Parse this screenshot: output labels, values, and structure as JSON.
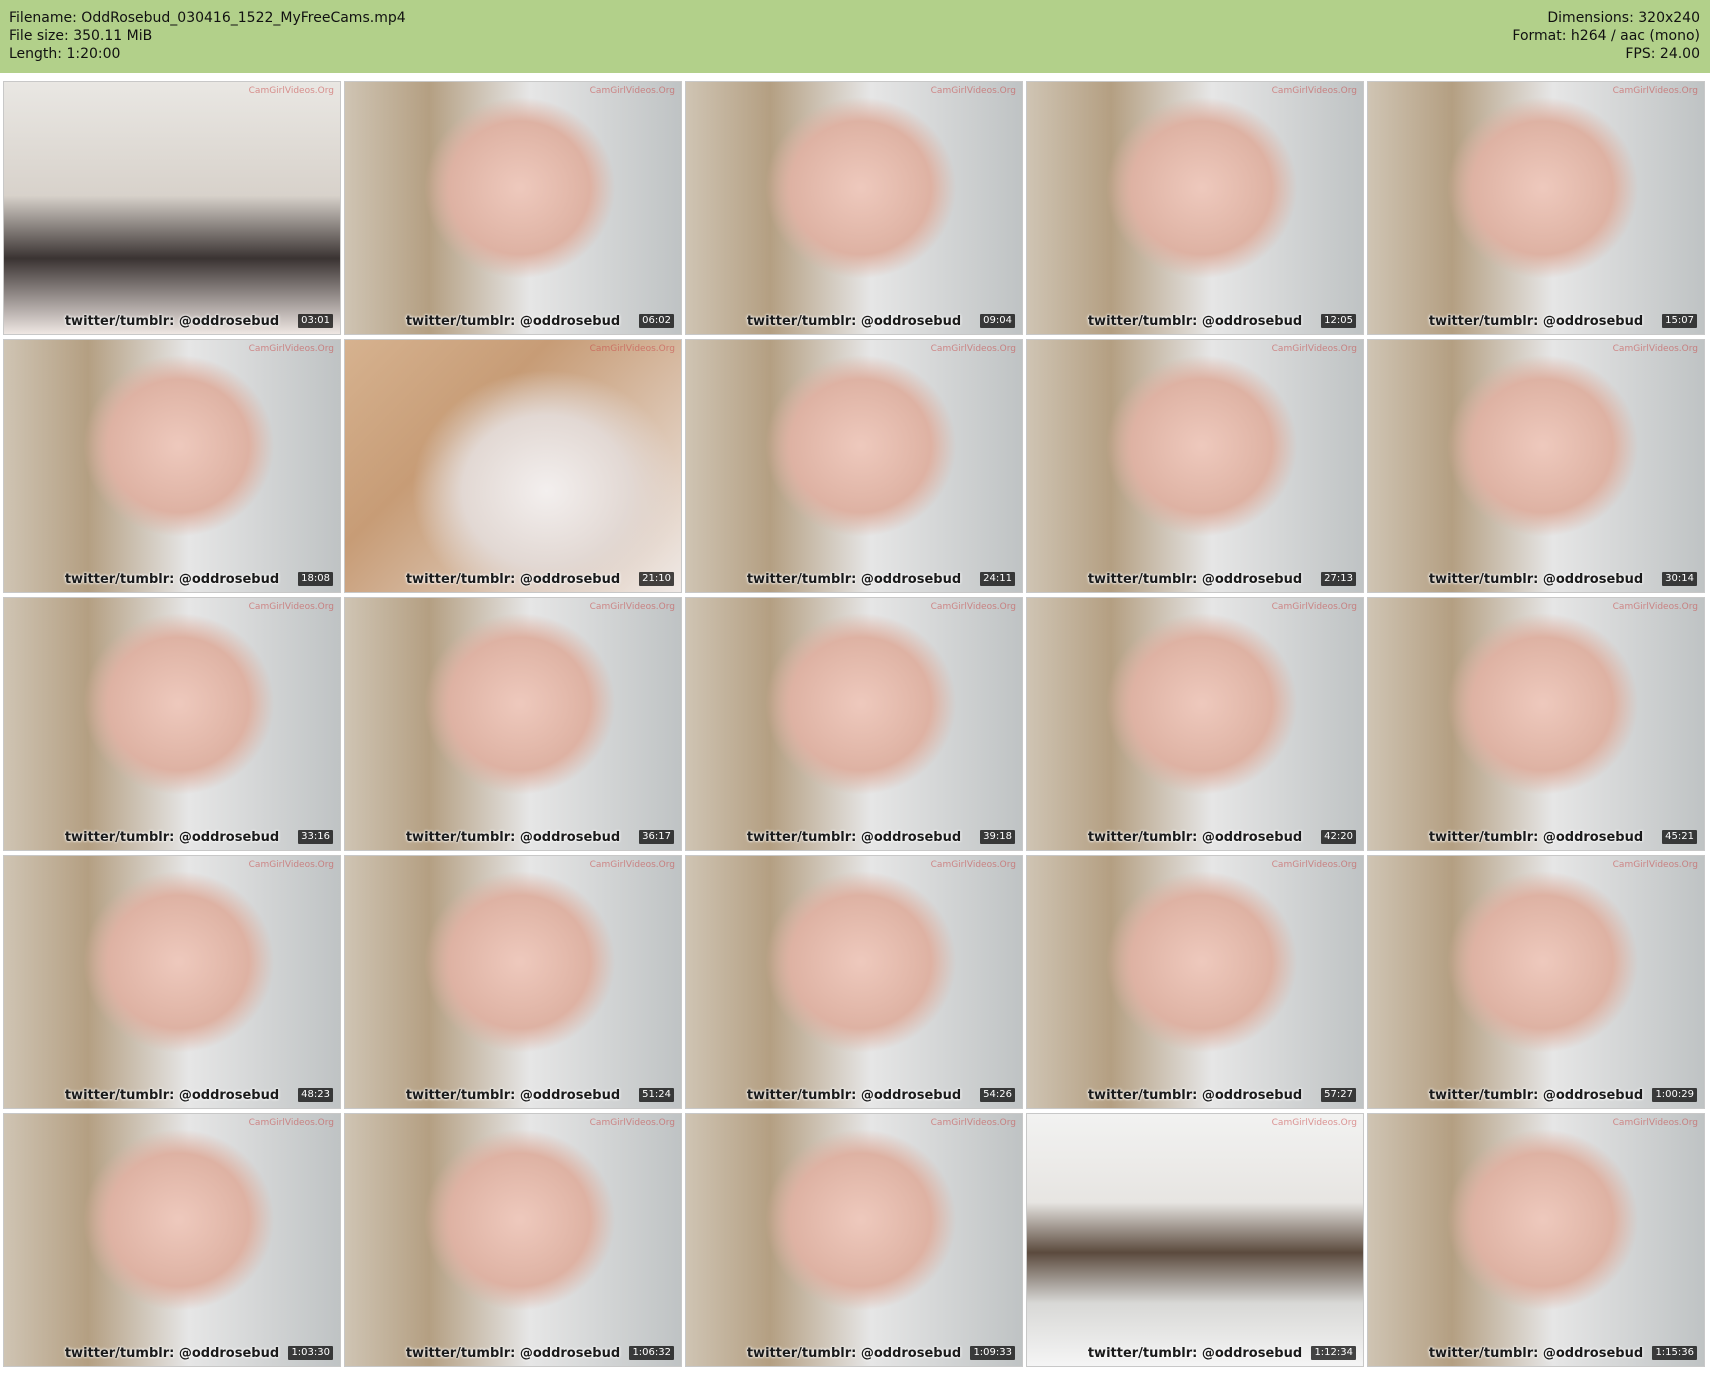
{
  "header": {
    "filename_line": "Filename: OddRosebud_030416_1522_MyFreeCams.mp4",
    "filesize_line": "File size: 350.11 MiB",
    "length_line": "Length: 1:20:00",
    "dimensions_line": "Dimensions: 320x240",
    "format_line": "Format: h264 / aac (mono)",
    "fps_line": "FPS: 24.00"
  },
  "watermark": "CamGirlVideos.Org",
  "thumbnails": [
    {
      "caption": "twitter/tumblr: @oddrosebud",
      "time": "03:01",
      "scene": "kitchen-wide"
    },
    {
      "caption": "twitter/tumblr: @oddrosebud",
      "time": "06:02",
      "scene": "face-closeup"
    },
    {
      "caption": "twitter/tumblr: @oddrosebud",
      "time": "09:04",
      "scene": "face-closeup"
    },
    {
      "caption": "twitter/tumblr: @oddrosebud",
      "time": "12:05",
      "scene": "face-closeup"
    },
    {
      "caption": "twitter/tumblr: @oddrosebud",
      "time": "15:07",
      "scene": "face-closeup"
    },
    {
      "caption": "twitter/tumblr: @oddrosebud",
      "time": "18:08",
      "scene": "face-closeup"
    },
    {
      "caption": "twitter/tumblr: @oddrosebud",
      "time": "21:10",
      "scene": "blurry"
    },
    {
      "caption": "twitter/tumblr: @oddrosebud",
      "time": "24:11",
      "scene": "face-closeup"
    },
    {
      "caption": "twitter/tumblr: @oddrosebud",
      "time": "27:13",
      "scene": "face-closeup"
    },
    {
      "caption": "twitter/tumblr: @oddrosebud",
      "time": "30:14",
      "scene": "face-closeup"
    },
    {
      "caption": "twitter/tumblr: @oddrosebud",
      "time": "33:16",
      "scene": "face-closeup"
    },
    {
      "caption": "twitter/tumblr: @oddrosebud",
      "time": "36:17",
      "scene": "face-closeup"
    },
    {
      "caption": "twitter/tumblr: @oddrosebud",
      "time": "39:18",
      "scene": "face-closeup"
    },
    {
      "caption": "twitter/tumblr: @oddrosebud",
      "time": "42:20",
      "scene": "face-closeup"
    },
    {
      "caption": "twitter/tumblr: @oddrosebud",
      "time": "45:21",
      "scene": "face-closeup"
    },
    {
      "caption": "twitter/tumblr: @oddrosebud",
      "time": "48:23",
      "scene": "face-closeup"
    },
    {
      "caption": "twitter/tumblr: @oddrosebud",
      "time": "51:24",
      "scene": "face-closeup"
    },
    {
      "caption": "twitter/tumblr: @oddrosebud",
      "time": "54:26",
      "scene": "face-closeup"
    },
    {
      "caption": "twitter/tumblr: @oddrosebud",
      "time": "57:27",
      "scene": "face-closeup"
    },
    {
      "caption": "twitter/tumblr: @oddrosebud",
      "time": "1:00:29",
      "scene": "face-closeup"
    },
    {
      "caption": "twitter/tumblr: @oddrosebud",
      "time": "1:03:30",
      "scene": "face-closeup"
    },
    {
      "caption": "twitter/tumblr: @oddrosebud",
      "time": "1:06:32",
      "scene": "face-closeup"
    },
    {
      "caption": "twitter/tumblr: @oddrosebud",
      "time": "1:09:33",
      "scene": "face-closeup"
    },
    {
      "caption": "twitter/tumblr: @oddrosebud",
      "time": "1:12:34",
      "scene": "empty-room"
    },
    {
      "caption": "twitter/tumblr: @oddrosebud",
      "time": "1:15:36",
      "scene": "face-closeup"
    }
  ]
}
